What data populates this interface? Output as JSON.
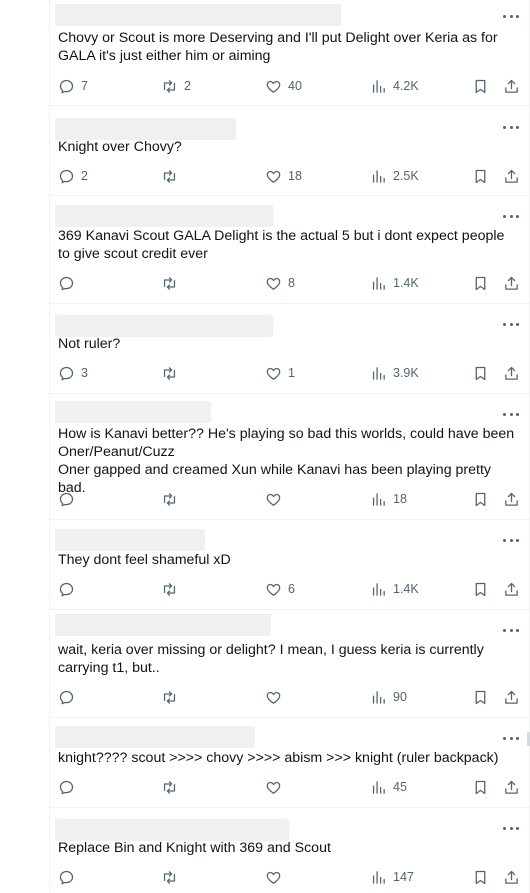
{
  "replies": [
    {
      "text": "Chovy or Scout is more Deserving and I'll put Delight over Keria as for GALA it's just either him or aiming",
      "counts": {
        "replies": "7",
        "reposts": "2",
        "likes": "40",
        "views": "4.2K"
      }
    },
    {
      "text": "Knight over Chovy?",
      "counts": {
        "replies": "2",
        "reposts": "",
        "likes": "18",
        "views": "2.5K"
      }
    },
    {
      "text": "369 Kanavi Scout GALA Delight is the actual 5 but i dont expect people to give scout credit ever",
      "counts": {
        "replies": "",
        "reposts": "",
        "likes": "8",
        "views": "1.4K"
      }
    },
    {
      "text": "Not ruler?",
      "counts": {
        "replies": "3",
        "reposts": "",
        "likes": "1",
        "views": "3.9K"
      }
    },
    {
      "text": "How is Kanavi better?? He's playing so bad this worlds, could have been Oner/Peanut/Cuzz\nOner gapped and creamed Xun while Kanavi has been playing pretty bad.",
      "counts": {
        "replies": "",
        "reposts": "",
        "likes": "",
        "views": "18"
      }
    },
    {
      "text": "They dont feel shameful xD",
      "counts": {
        "replies": "",
        "reposts": "",
        "likes": "6",
        "views": "1.4K"
      }
    },
    {
      "text": "wait, keria over missing or delight? I mean, I guess keria is currently carrying t1, but..",
      "counts": {
        "replies": "",
        "reposts": "",
        "likes": "",
        "views": "90"
      }
    },
    {
      "text": "knight???? scout >>>> chovy >>>> abism >>> knight (ruler backpack)",
      "counts": {
        "replies": "",
        "reposts": "",
        "likes": "",
        "views": "45"
      }
    },
    {
      "text": "Replace Bin and Knight with 369 and Scout",
      "counts": {
        "replies": "",
        "reposts": "",
        "likes": "",
        "views": "147"
      }
    }
  ]
}
